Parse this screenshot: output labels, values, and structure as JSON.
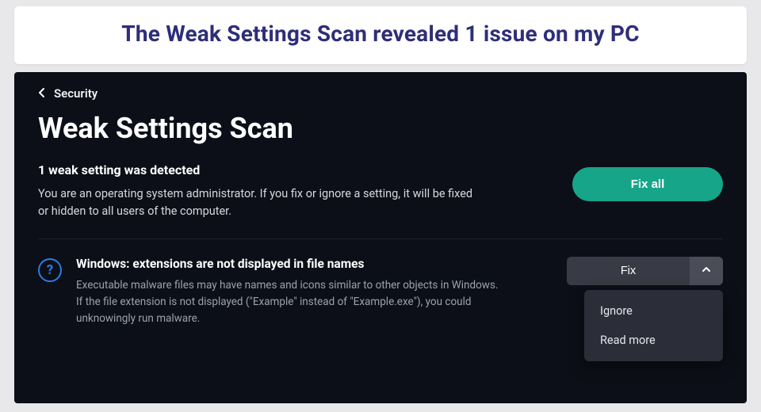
{
  "caption": "The Weak Settings Scan revealed 1 issue on my PC",
  "breadcrumb": {
    "parent": "Security"
  },
  "page_title": "Weak Settings Scan",
  "summary": {
    "heading": "1 weak setting was detected",
    "body": "You are an operating system administrator. If you fix or ignore a setting, it will be fixed or hidden to all users of the computer.",
    "fix_all_label": "Fix all"
  },
  "issue": {
    "icon_name": "question-icon",
    "title": "Windows: extensions are not displayed in file names",
    "description": "Executable malware files may have names and icons similar to other objects in Windows. If the file extension is not displayed (\"Example\" instead of \"Example.exe\"), you could unknowingly run malware.",
    "fix_label": "Fix",
    "menu": {
      "ignore": "Ignore",
      "read_more": "Read more"
    }
  },
  "colors": {
    "accent_green": "#17a589",
    "accent_blue": "#2a7de1",
    "bg_dark": "#0c0f17",
    "caption_text": "#2e2e78"
  }
}
